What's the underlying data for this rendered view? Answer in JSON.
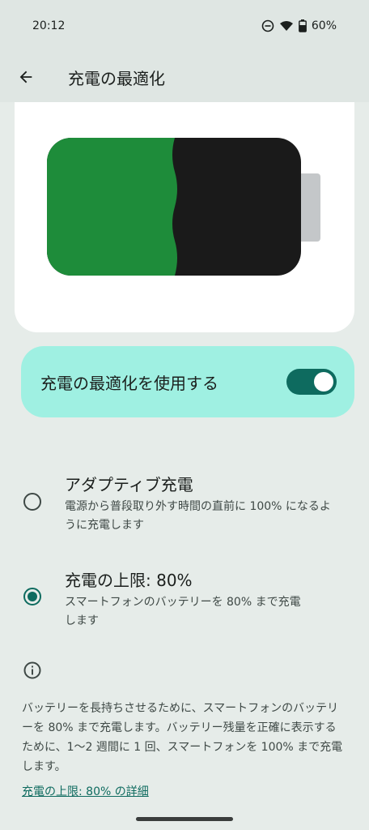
{
  "status_bar": {
    "time": "20:12",
    "battery_percent": "60%",
    "icons": [
      "dnd-icon",
      "wifi-icon",
      "battery-icon"
    ]
  },
  "app_bar": {
    "back_icon": "arrow-back-icon",
    "title": "充電の最適化"
  },
  "battery_illustration": {
    "charge_fill_color": "#1e8c3a",
    "empty_color": "#1a1a1a",
    "terminal_color": "#c4c7c9"
  },
  "main_toggle": {
    "label": "充電の最適化を使用する",
    "state": "on"
  },
  "options": [
    {
      "title": "アダプティブ充電",
      "description": "電源から普段取り外す時間の直前に 100% になるように充電します",
      "selected": false
    },
    {
      "title": "充電の上限: 80%",
      "description": "スマートフォンのバッテリーを 80% まで充電します",
      "selected": true
    }
  ],
  "info": {
    "icon": "info-icon",
    "text": "バッテリーを長持ちさせるために、スマートフォンのバッテリーを 80% まで充電します。バッテリー残量を正確に表示するために、1〜2 週間に 1 回、スマートフォンを 100% まで充電します。",
    "link": "充電の上限: 80% の詳細"
  },
  "colors": {
    "accent": "#0e6b5f",
    "toggle_card_bg": "#9ff0e2",
    "background": "#e6ece9"
  }
}
